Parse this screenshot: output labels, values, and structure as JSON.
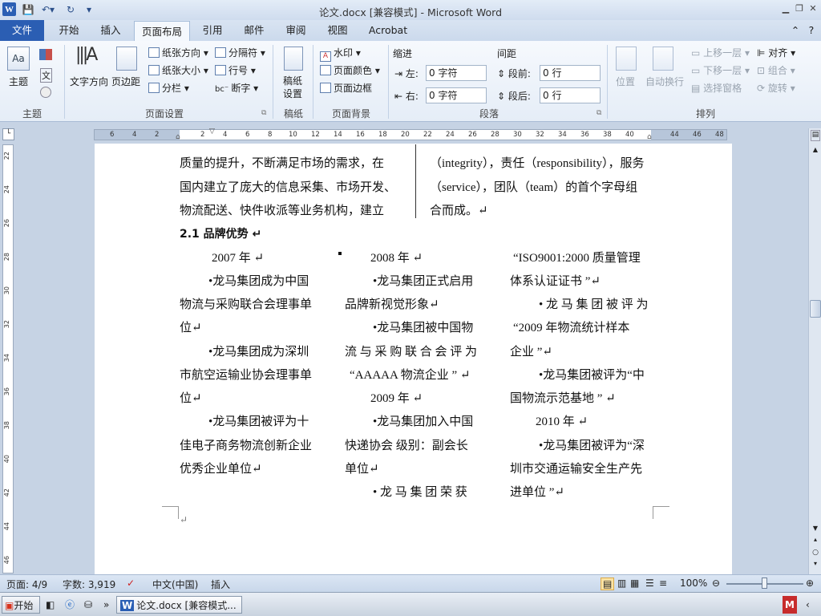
{
  "window": {
    "title": "论文.docx [兼容模式] - Microsoft Word",
    "app_icon": "W"
  },
  "tabs": [
    {
      "label": "文件"
    },
    {
      "label": "开始"
    },
    {
      "label": "插入"
    },
    {
      "label": "页面布局"
    },
    {
      "label": "引用"
    },
    {
      "label": "邮件"
    },
    {
      "label": "审阅"
    },
    {
      "label": "视图"
    },
    {
      "label": "Acrobat"
    }
  ],
  "ribbon": {
    "theme": {
      "themes": "主题",
      "group": "主题"
    },
    "page_setup": {
      "text_direction": "文字方向",
      "margins": "页边距",
      "orientation": "纸张方向",
      "size": "纸张大小",
      "columns": "分栏",
      "breaks": "分隔符",
      "line_numbers": "行号",
      "hyphenation": "断字",
      "group": "页面设置"
    },
    "draft_paper": {
      "label": "稿纸\n设置",
      "group": "稿纸"
    },
    "page_background": {
      "watermark": "水印",
      "page_color": "页面颜色",
      "page_borders": "页面边框",
      "group": "页面背景"
    },
    "paragraph": {
      "indent_title": "缩进",
      "spacing_title": "间距",
      "left_label": "左:",
      "left_value": "0 字符",
      "right_label": "右:",
      "right_value": "0 字符",
      "before_label": "段前:",
      "before_value": "0 行",
      "after_label": "段后:",
      "after_value": "0 行",
      "group": "段落"
    },
    "arrange": {
      "position": "位置",
      "wrap": "自动换行",
      "forward": "上移一层",
      "backward": "下移一层",
      "selection": "选择窗格",
      "align": "对齐",
      "group_btn": "组合",
      "rotate": "旋转",
      "group": "排列"
    }
  },
  "ruler": {
    "h_ticks": [
      "6",
      "4",
      "2",
      "2",
      "4",
      "6",
      "8",
      "10",
      "12",
      "14",
      "16",
      "18",
      "20",
      "22",
      "24",
      "26",
      "28",
      "30",
      "32",
      "34",
      "36",
      "38",
      "40",
      "44",
      "46",
      "48"
    ],
    "v_ticks": [
      "22",
      "24",
      "26",
      "28",
      "30",
      "32",
      "34",
      "36",
      "38",
      "40",
      "42",
      "44",
      "46"
    ]
  },
  "document": {
    "left_top": [
      "质量的提升，不断满足市场的需求，在",
      "国内建立了庞大的信息采集、市场开发、",
      "物流配送、快件收派等业务机构，建立"
    ],
    "right_top": [
      "（integrity），责任（responsibility），服务",
      "（service），团队（team）的首个字母组",
      "合而成。↵"
    ],
    "heading": "2.1  品牌优势 ↵",
    "col1": [
      "2007 年  ↵",
      "•龙马集团成为中国",
      "物流与采购联合会理事单",
      "位↵",
      "•龙马集团成为深圳",
      "市航空运输业协会理事单",
      "位↵",
      "•龙马集团被评为十",
      "佳电子商务物流创新企业",
      "优秀企业单位↵"
    ],
    "col2": [
      "2008 年  ↵",
      "•龙马集团正式启用",
      "品牌新视觉形象↵",
      "•龙马集团被中国物",
      "流 与 采 购 联 合 会 评 为",
      "“AAAAA 物流企业 ”  ↵",
      "2009 年  ↵",
      "•龙马集团加入中国",
      "快递协会     级别：副会长",
      "单位↵",
      "• 龙 马 集 团 荣 获"
    ],
    "col3": [
      "“ISO9001:2000 质量管理",
      "体系认证证书 ”↵",
      "• 龙 马 集 团 被 评 为",
      "“2009  年物流统计样本",
      "企业 ”↵",
      "•龙马集团被评为“中",
      "国物流示范基地 ” ↵",
      "2010 年  ↵",
      "•龙马集团被评为“深",
      "圳市交通运输安全生产先",
      "进单位 ”↵"
    ],
    "end_mark": "↵"
  },
  "status": {
    "page": "页面: 4/9",
    "words": "字数: 3,919",
    "language": "中文(中国)",
    "mode": "插入",
    "zoom": "100%"
  },
  "taskbar": {
    "start": "开始",
    "task_item": "论文.docx [兼容模式..."
  }
}
